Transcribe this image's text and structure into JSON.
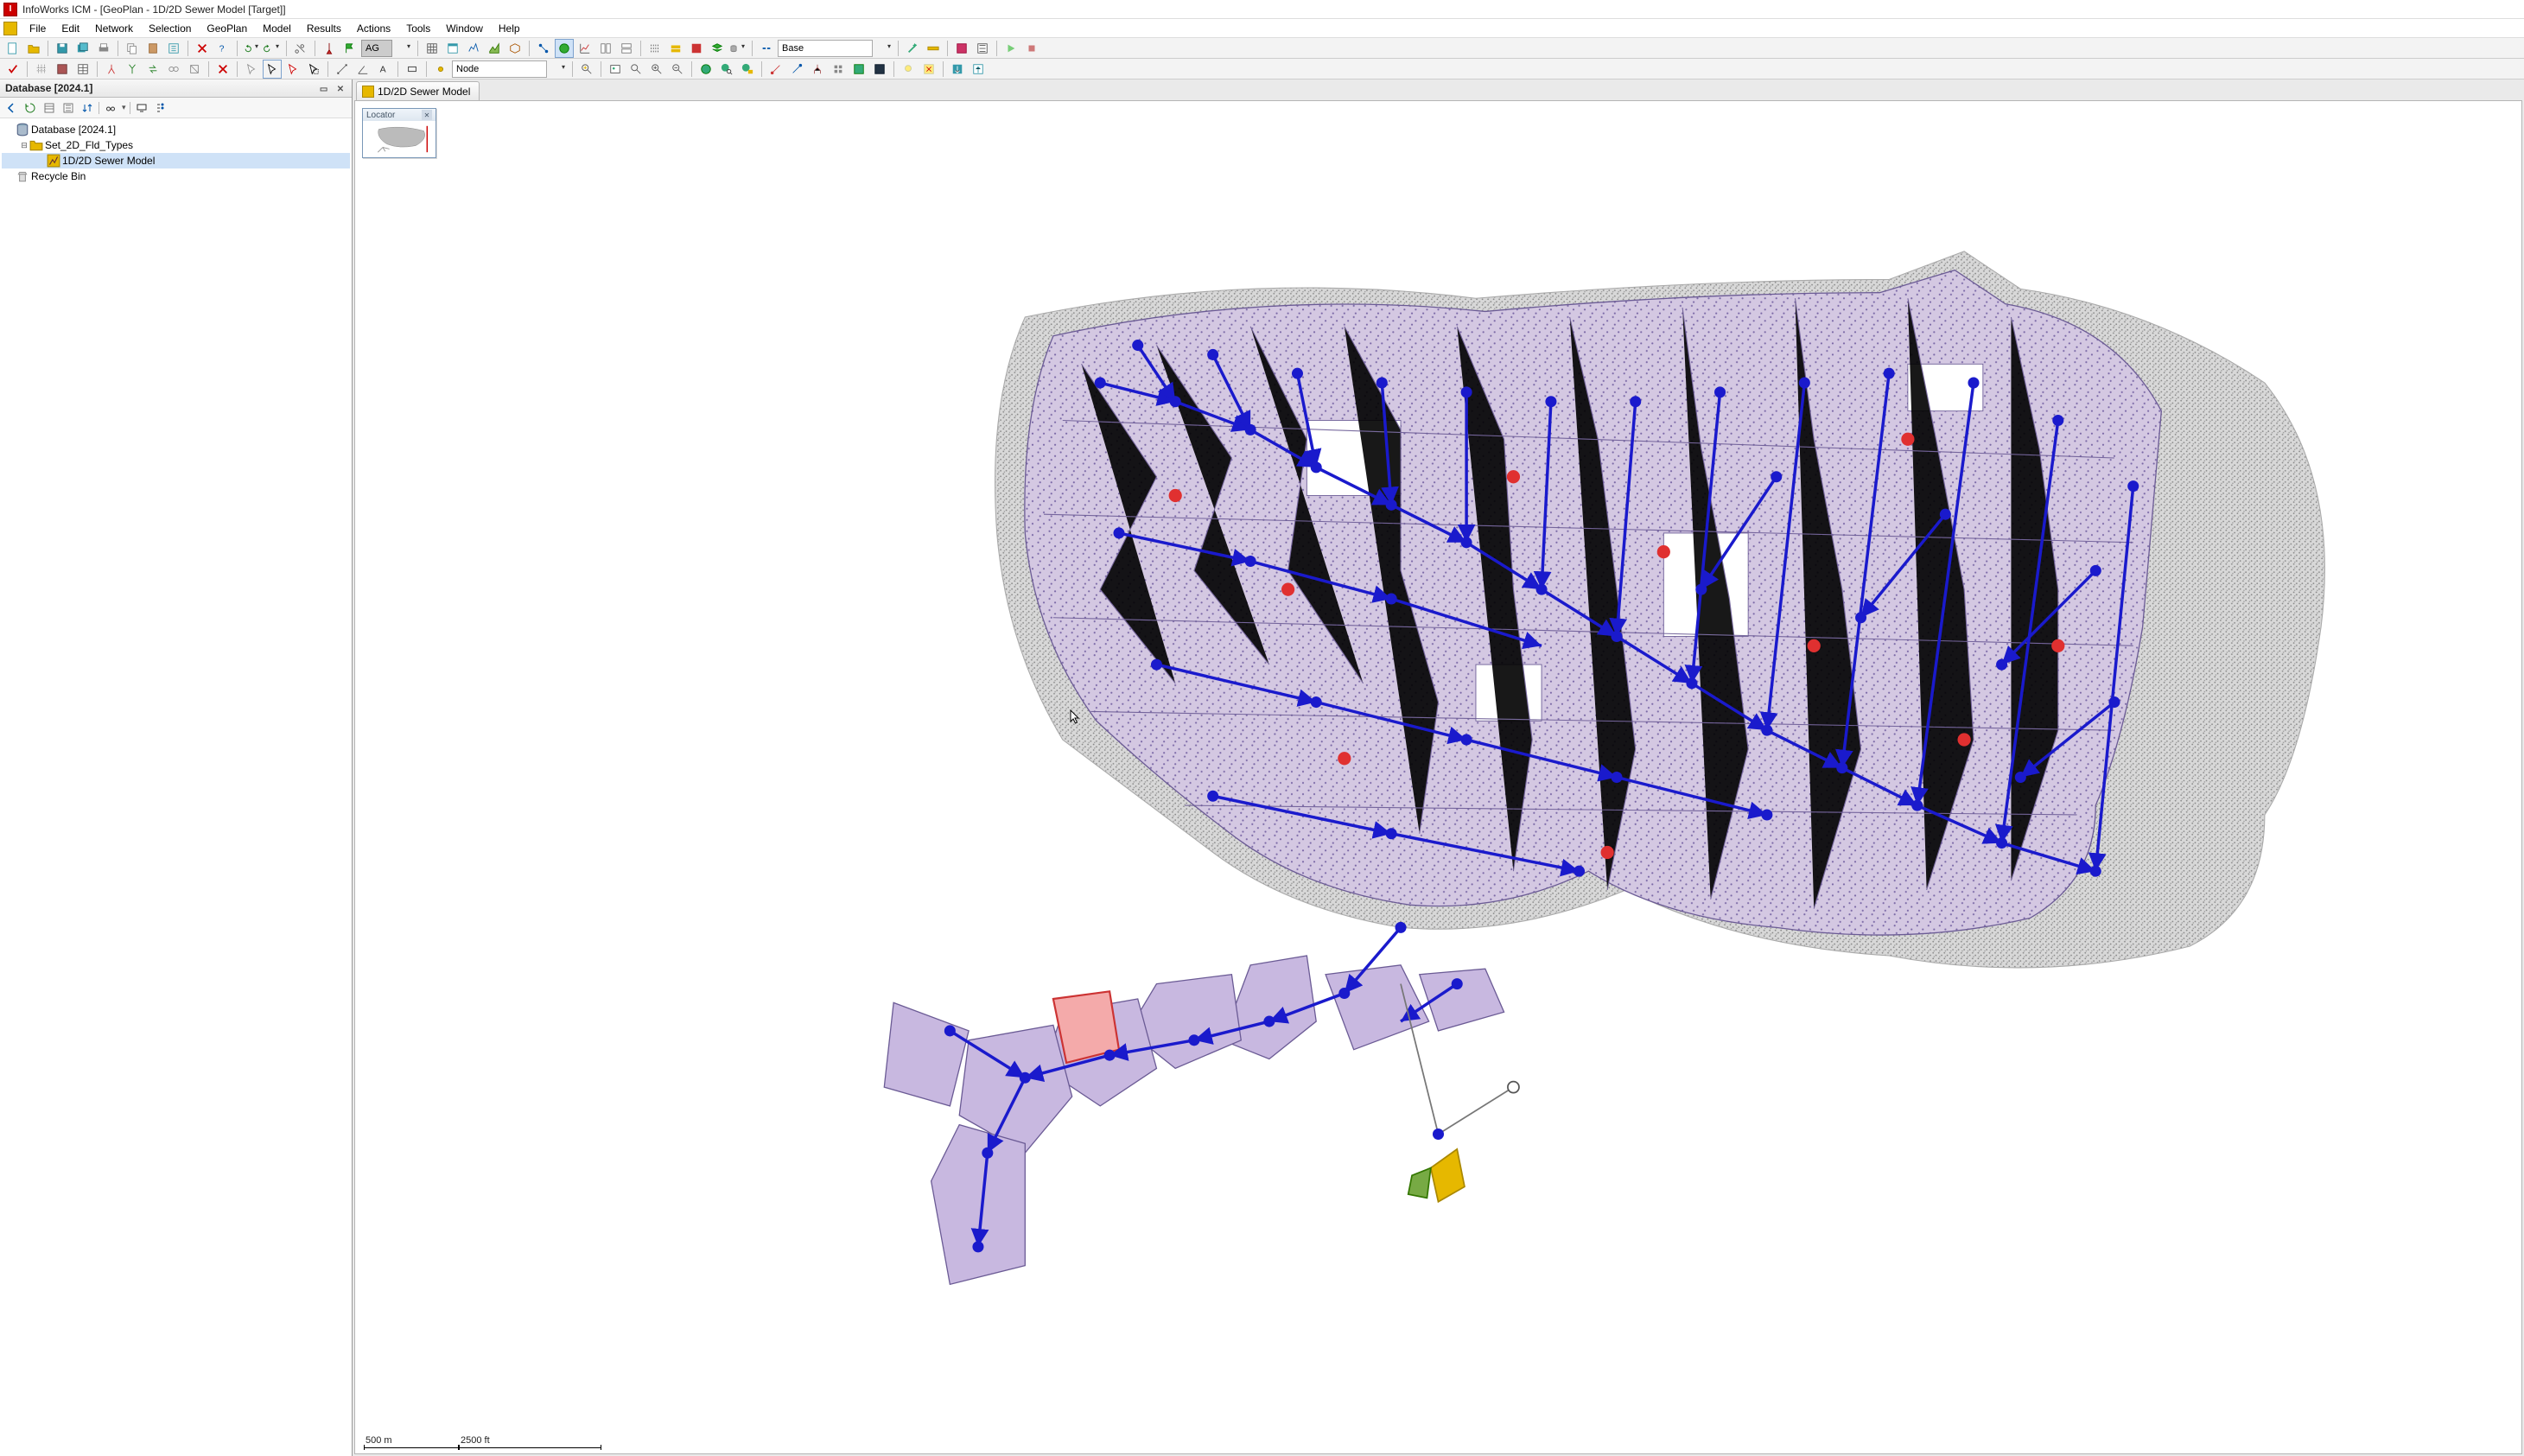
{
  "title": "InfoWorks ICM          - [GeoPlan - 1D/2D Sewer Model [Target]]",
  "menus": [
    "File",
    "Edit",
    "Network",
    "Selection",
    "GeoPlan",
    "Model",
    "Results",
    "Actions",
    "Tools",
    "Window",
    "Help"
  ],
  "toolbar1": {
    "ag_label": "AG",
    "scenario_label": "Base"
  },
  "toolbar2": {
    "object_type": "Node"
  },
  "database_panel": {
    "title": "Database [2024.1]"
  },
  "tree": {
    "root": "Database [2024.1]",
    "group": "Set_2D_Fld_Types",
    "network": "1D/2D Sewer Model",
    "recycle": "Recycle Bin"
  },
  "doc_tab": "1D/2D Sewer Model",
  "locator": {
    "title": "Locator"
  },
  "scale": {
    "metric": "500 m",
    "imperial": "2500 ft"
  }
}
